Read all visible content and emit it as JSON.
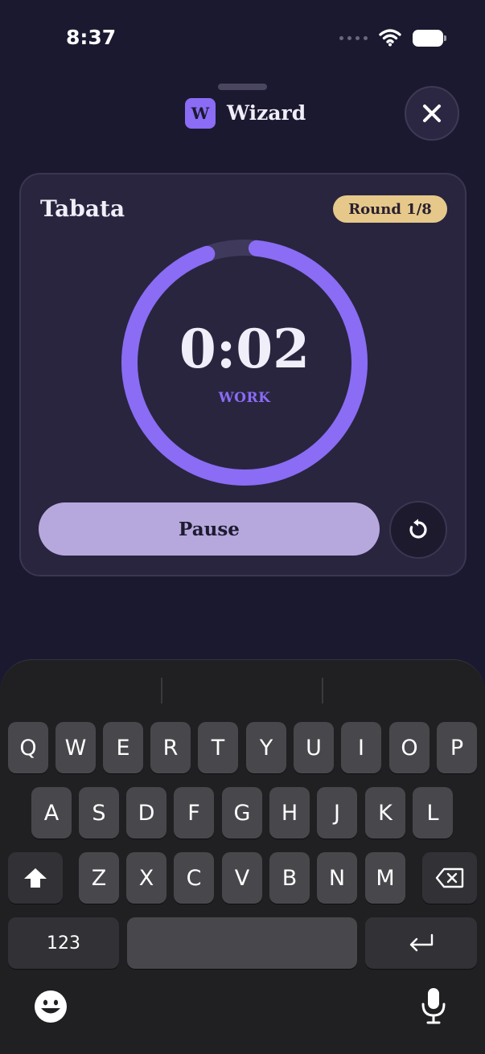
{
  "status_bar": {
    "time": "8:37"
  },
  "header": {
    "logo_letter": "W",
    "title": "Wizard"
  },
  "timer": {
    "title": "Tabata",
    "round_badge": "Round 1/8",
    "time": "0:02",
    "phase": "WORK",
    "progress_remaining_fraction": 0.93,
    "pause_label": "Pause",
    "accent_color": "#8a6cf5",
    "track_color": "#3f3a5c",
    "badge_color": "#e6c98a"
  },
  "keyboard": {
    "row1": [
      "Q",
      "W",
      "E",
      "R",
      "T",
      "Y",
      "U",
      "I",
      "O",
      "P"
    ],
    "row2": [
      "A",
      "S",
      "D",
      "F",
      "G",
      "H",
      "J",
      "K",
      "L"
    ],
    "row3": [
      "Z",
      "X",
      "C",
      "V",
      "B",
      "N",
      "M"
    ],
    "numbers_label": "123"
  },
  "icons": {
    "close": "close-icon",
    "reset": "reset-icon",
    "shift": "shift-icon",
    "backspace": "backspace-icon",
    "return": "return-icon",
    "emoji": "emoji-icon",
    "mic": "mic-icon",
    "wifi": "wifi-icon",
    "battery": "battery-icon"
  }
}
